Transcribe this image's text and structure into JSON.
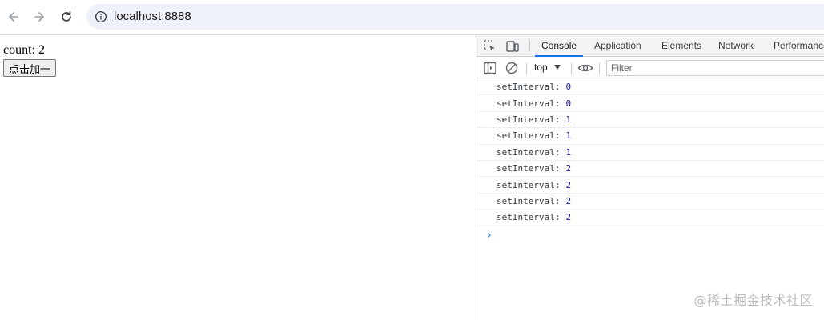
{
  "browser": {
    "url": "localhost:8888",
    "icons": {
      "back": "arrow-left-icon",
      "forward": "arrow-right-icon",
      "reload": "reload-icon",
      "site_info": "info-circle-icon"
    }
  },
  "page": {
    "count_text": "count: 2",
    "button_label": "点击加一"
  },
  "devtools": {
    "tabs": [
      {
        "label": "Console",
        "active": true
      },
      {
        "label": "Application",
        "active": false
      },
      {
        "label": "Elements",
        "active": false
      },
      {
        "label": "Network",
        "active": false
      },
      {
        "label": "Performance",
        "active": false
      }
    ],
    "context": "top",
    "filter_placeholder": "Filter",
    "accent_color": "#1a73e8",
    "logs": [
      {
        "text": "setInterval:",
        "value": "0"
      },
      {
        "text": "setInterval:",
        "value": "0"
      },
      {
        "text": "setInterval:",
        "value": "1"
      },
      {
        "text": "setInterval:",
        "value": "1"
      },
      {
        "text": "setInterval:",
        "value": "1"
      },
      {
        "text": "setInterval:",
        "value": "2"
      },
      {
        "text": "setInterval:",
        "value": "2"
      },
      {
        "text": "setInterval:",
        "value": "2"
      },
      {
        "text": "setInterval:",
        "value": "2"
      }
    ],
    "prompt": "›"
  },
  "watermark": "@稀土掘金技术社区"
}
